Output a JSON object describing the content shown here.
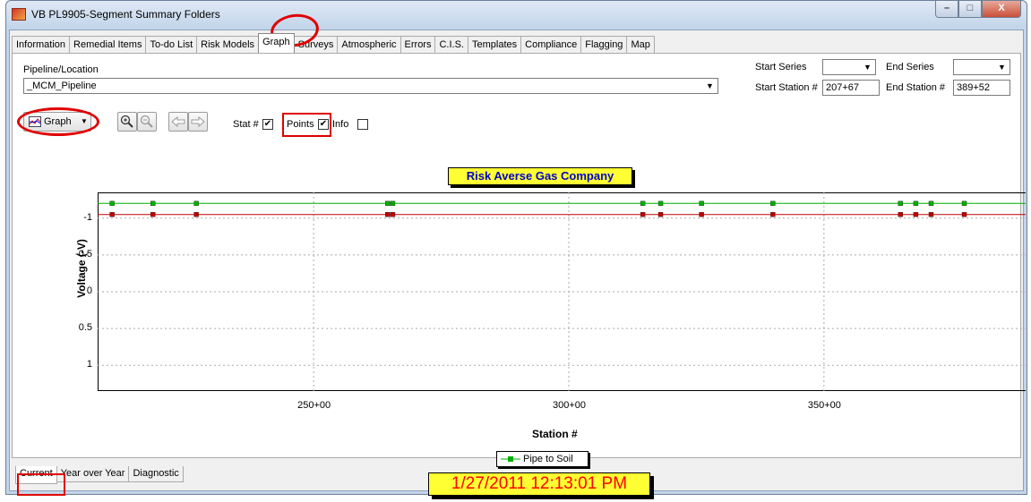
{
  "window": {
    "title": "VB PL9905-Segment Summary Folders",
    "controls": {
      "minimize": "–",
      "maximize": "□",
      "close": "X"
    }
  },
  "tabs": [
    "Information",
    "Remedial Items",
    "To-do List",
    "Risk Models",
    "Graph",
    "Surveys",
    "Atmospheric",
    "Errors",
    "C.I.S.",
    "Templates",
    "Compliance",
    "Flagging",
    "Map"
  ],
  "active_tab": "Graph",
  "filters": {
    "pipeline_label": "Pipeline/Location",
    "pipeline_value": "_MCM_Pipeline",
    "start_series_label": "Start Series",
    "start_series_value": "",
    "end_series_label": "End Series",
    "end_series_value": "",
    "start_station_label": "Start Station #",
    "start_station_value": "207+67",
    "end_station_label": "End Station #",
    "end_station_value": "389+52"
  },
  "toolbar": {
    "graph_button": "Graph",
    "stat_label": "Stat #",
    "stat_checked": true,
    "points_label": "Points",
    "points_checked": true,
    "info_label": "Info",
    "info_checked": false,
    "check_mark": "✔"
  },
  "chart_data": {
    "type": "line",
    "title": "Risk Averse Gas Company",
    "xlabel": "Station #",
    "ylabel": "Voltage (-V)",
    "x_ticks": [
      "250+00",
      "300+00",
      "350+00"
    ],
    "x_tick_values": [
      250,
      300,
      350
    ],
    "xlim": [
      207.67,
      389.52
    ],
    "y_ticks": [
      "-1",
      "-0.5",
      "0",
      "0.5",
      "1"
    ],
    "y_tick_values": [
      -1,
      -0.5,
      0,
      0.5,
      1
    ],
    "ylim": [
      -1.35,
      1.35
    ],
    "y_inverted": true,
    "grid": true,
    "legend_position": "bottom-center",
    "series": [
      {
        "name": "Pipe to Soil",
        "color": "#00b000",
        "points": [
          [
            207.67,
            -1.2
          ],
          [
            210.5,
            -1.2
          ],
          [
            218.5,
            -1.2
          ],
          [
            227,
            -1.2
          ],
          [
            264.5,
            -1.2
          ],
          [
            265.5,
            -1.2
          ],
          [
            314.5,
            -1.2
          ],
          [
            318,
            -1.2
          ],
          [
            326,
            -1.2
          ],
          [
            340,
            -1.2
          ],
          [
            365,
            -1.2
          ],
          [
            368,
            -1.2
          ],
          [
            371,
            -1.2
          ],
          [
            377.5,
            -1.2
          ],
          [
            389.52,
            -1.2
          ]
        ]
      },
      {
        "name": "",
        "color": "#c00000",
        "points": [
          [
            207.67,
            -1.05
          ],
          [
            210.5,
            -1.05
          ],
          [
            218.5,
            -1.05
          ],
          [
            227,
            -1.05
          ],
          [
            264.5,
            -1.05
          ],
          [
            265.5,
            -1.05
          ],
          [
            314.5,
            -1.05
          ],
          [
            318,
            -1.05
          ],
          [
            326,
            -1.05
          ],
          [
            340,
            -1.05
          ],
          [
            365,
            -1.05
          ],
          [
            368,
            -1.05
          ],
          [
            371,
            -1.05
          ],
          [
            377.5,
            -1.05
          ],
          [
            389.52,
            -1.05
          ]
        ]
      }
    ]
  },
  "legend": {
    "label": "Pipe to Soil"
  },
  "timestamp": "1/27/2011 12:13:01 PM",
  "bottom_tabs": [
    "Current",
    "Year over Year",
    "Diagnostic"
  ],
  "active_bottom_tab": "Current"
}
